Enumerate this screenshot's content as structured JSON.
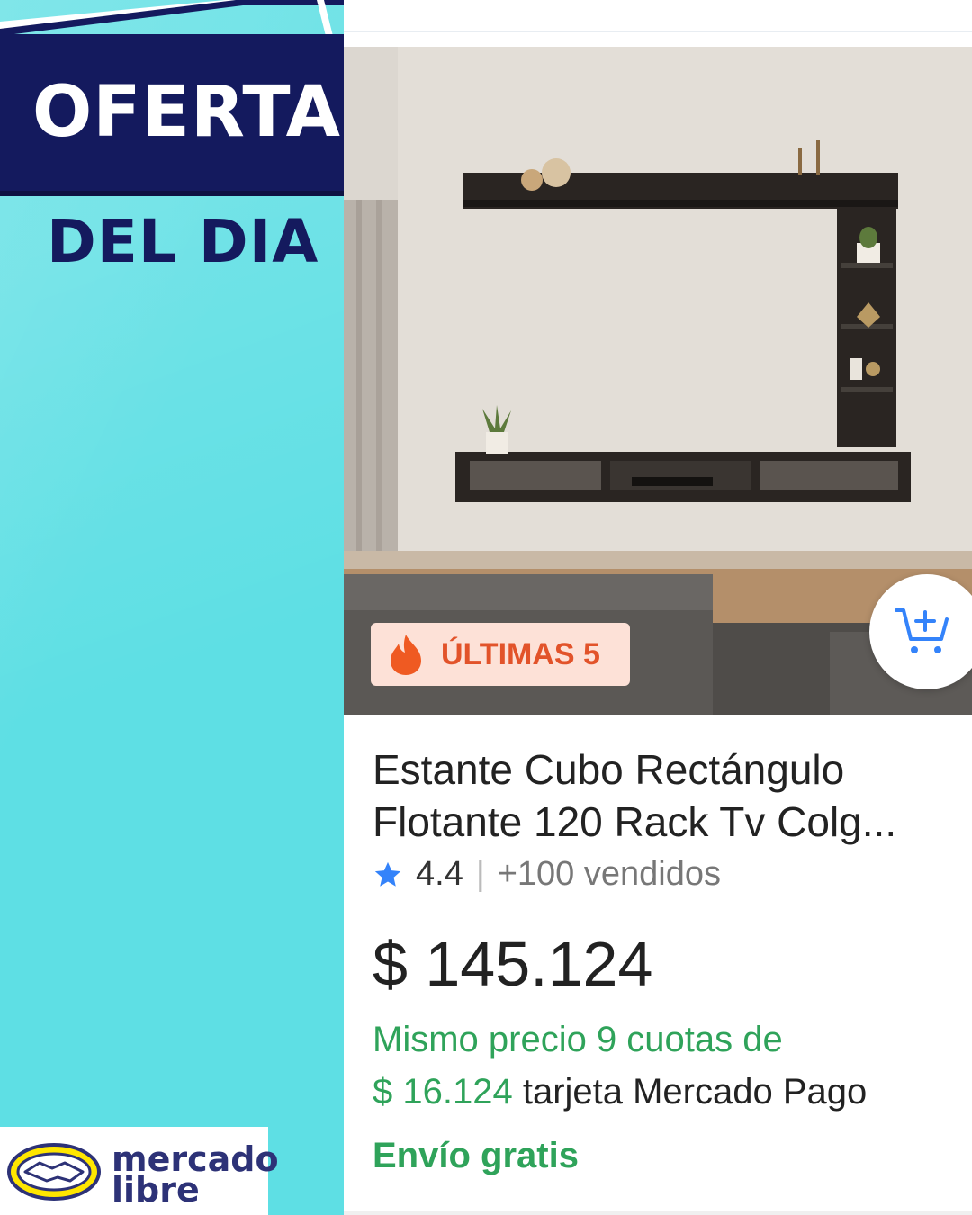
{
  "promo": {
    "headline": "OFERTAS",
    "subheadline": "DEL DIA"
  },
  "product": {
    "badge_label": "ÚLTIMAS 5",
    "badge_icon": "flame-icon",
    "cart_icon": "add-to-cart-icon",
    "title": "Estante Cubo Rectángulo Flotante 120 Rack Tv Colg...",
    "rating": "4.4",
    "separator": "|",
    "sold": "+100 vendidos",
    "price": "$ 145.124",
    "installments_text": "Mismo precio 9 cuotas de",
    "installment_amount": "$ 16.124",
    "installment_method": "tarjeta Mercado Pago",
    "shipping": "Envío gratis"
  },
  "brand": {
    "logo_line1": "mercado",
    "logo_line2": "libre"
  },
  "colors": {
    "background": "#5edfe4",
    "banner": "#141a5e",
    "accent_green": "#2fa35a",
    "badge_bg": "#fde1d7",
    "badge_text": "#e2532a",
    "star": "#3483fa",
    "brand_yellow": "#ffe600"
  }
}
